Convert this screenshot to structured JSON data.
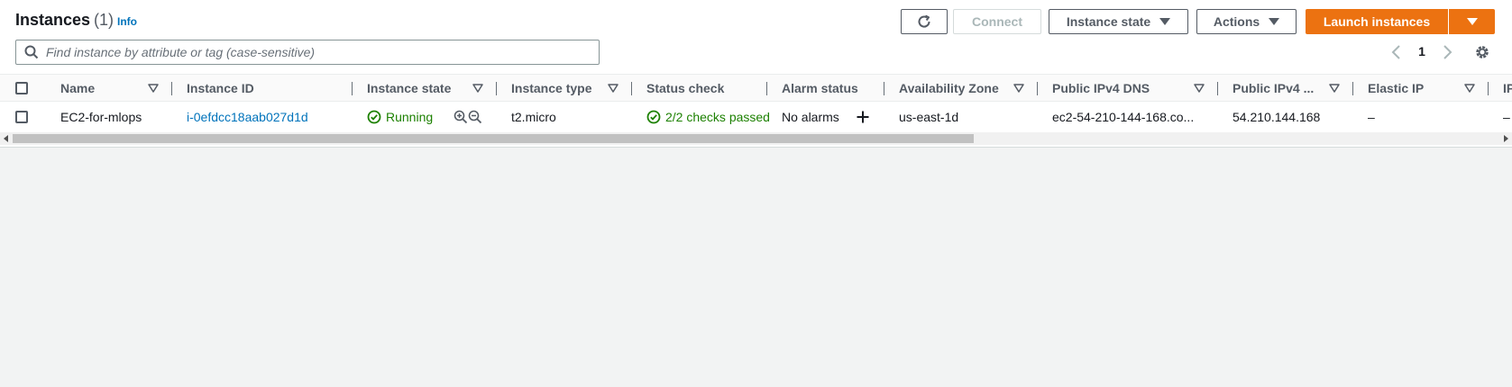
{
  "header": {
    "title": "Instances",
    "count": "(1)",
    "info": "Info",
    "buttons": {
      "refresh_icon": "refresh-icon",
      "connect": "Connect",
      "instance_state": "Instance state",
      "actions": "Actions",
      "launch": "Launch instances"
    }
  },
  "search": {
    "placeholder": "Find instance by attribute or tag (case-sensitive)",
    "value": ""
  },
  "pagination": {
    "page": "1"
  },
  "table": {
    "columns": [
      "Name",
      "Instance ID",
      "Instance state",
      "Instance type",
      "Status check",
      "Alarm status",
      "Availability Zone",
      "Public IPv4 DNS",
      "Public IPv4 ...",
      "Elastic IP",
      "IP"
    ],
    "rows": [
      {
        "name": "EC2-for-mlops",
        "instance_id": "i-0efdcc18aab027d1d",
        "state": "Running",
        "type": "t2.micro",
        "status_check": "2/2 checks passed",
        "alarm_status": "No alarms",
        "az": "us-east-1d",
        "dns": "ec2-54-210-144-168.co...",
        "ipv4": "54.210.144.168",
        "elastic_ip": "–",
        "ip": "–"
      }
    ]
  },
  "colors": {
    "primary": "#ec7211",
    "link": "#0073bb",
    "success": "#1d8102",
    "background": "#f2f3f3"
  }
}
